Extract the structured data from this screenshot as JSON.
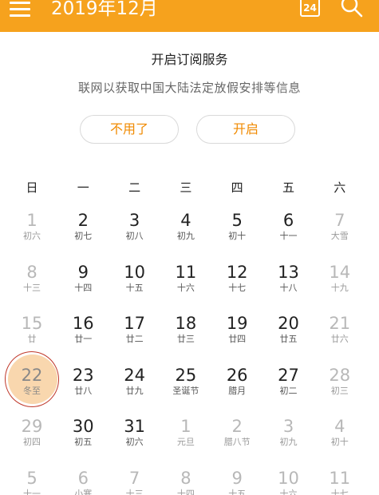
{
  "header": {
    "month_title": "2019年12月",
    "today_number": "24",
    "accent_color": "#f6a21d",
    "icons": [
      "menu-icon",
      "calendar-today-icon",
      "search-icon"
    ]
  },
  "subscription": {
    "title": "开启订阅服务",
    "description": "联网以获取中国大陆法定放假安排等信息",
    "decline_label": "不用了",
    "enable_label": "开启"
  },
  "weekdays": [
    "日",
    "一",
    "二",
    "三",
    "四",
    "五",
    "六"
  ],
  "weeks": [
    [
      {
        "day": "1",
        "lunar": "初六",
        "dim": true
      },
      {
        "day": "2",
        "lunar": "初七"
      },
      {
        "day": "3",
        "lunar": "初八"
      },
      {
        "day": "4",
        "lunar": "初九"
      },
      {
        "day": "5",
        "lunar": "初十"
      },
      {
        "day": "6",
        "lunar": "十一"
      },
      {
        "day": "7",
        "lunar": "大雪",
        "dim": true
      }
    ],
    [
      {
        "day": "8",
        "lunar": "十三",
        "dim": true
      },
      {
        "day": "9",
        "lunar": "十四"
      },
      {
        "day": "10",
        "lunar": "十五"
      },
      {
        "day": "11",
        "lunar": "十六"
      },
      {
        "day": "12",
        "lunar": "十七"
      },
      {
        "day": "13",
        "lunar": "十八"
      },
      {
        "day": "14",
        "lunar": "十九",
        "dim": true
      }
    ],
    [
      {
        "day": "15",
        "lunar": "廿",
        "dim": true
      },
      {
        "day": "16",
        "lunar": "廿一"
      },
      {
        "day": "17",
        "lunar": "廿二"
      },
      {
        "day": "18",
        "lunar": "廿三"
      },
      {
        "day": "19",
        "lunar": "廿四"
      },
      {
        "day": "20",
        "lunar": "廿五"
      },
      {
        "day": "21",
        "lunar": "廿六",
        "dim": true
      }
    ],
    [
      {
        "day": "22",
        "lunar": "冬至",
        "today": true
      },
      {
        "day": "23",
        "lunar": "廿八"
      },
      {
        "day": "24",
        "lunar": "廿九"
      },
      {
        "day": "25",
        "lunar": "圣诞节"
      },
      {
        "day": "26",
        "lunar": "腊月"
      },
      {
        "day": "27",
        "lunar": "初二"
      },
      {
        "day": "28",
        "lunar": "初三",
        "dim": true
      }
    ],
    [
      {
        "day": "29",
        "lunar": "初四",
        "dim": true
      },
      {
        "day": "30",
        "lunar": "初五"
      },
      {
        "day": "31",
        "lunar": "初六"
      },
      {
        "day": "1",
        "lunar": "元旦",
        "dim": true
      },
      {
        "day": "2",
        "lunar": "腊八节",
        "dim": true
      },
      {
        "day": "3",
        "lunar": "初九",
        "dim": true
      },
      {
        "day": "4",
        "lunar": "初十",
        "dim": true
      }
    ],
    [
      {
        "day": "5",
        "lunar": "十一",
        "dim": true
      },
      {
        "day": "6",
        "lunar": "小寒",
        "dim": true
      },
      {
        "day": "7",
        "lunar": "十三",
        "dim": true
      },
      {
        "day": "8",
        "lunar": "十四",
        "dim": true
      },
      {
        "day": "9",
        "lunar": "十五",
        "dim": true
      },
      {
        "day": "10",
        "lunar": "十六",
        "dim": true
      },
      {
        "day": "11",
        "lunar": "十七",
        "dim": true
      }
    ]
  ]
}
